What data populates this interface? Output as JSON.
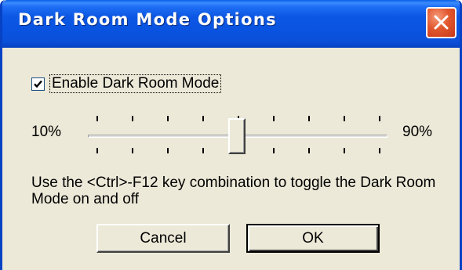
{
  "window": {
    "title": "Dark Room Mode Options"
  },
  "titlebar": {
    "close_icon": "close-x-icon"
  },
  "options": {
    "enable_checkbox": {
      "label": "Enable Dark Room Mode",
      "checked": true
    }
  },
  "slider": {
    "min_label": "10%",
    "max_label": "90%",
    "min": 10,
    "max": 90,
    "value": 50,
    "tick_count": 9
  },
  "help": {
    "text": "Use the <Ctrl>-F12 key combination to toggle the Dark Room Mode on and off"
  },
  "buttons": {
    "cancel_label": "Cancel",
    "ok_label": "OK"
  },
  "colors": {
    "titlebar": "#0a5fe6",
    "close_button": "#e2582d",
    "dialog_background": "#ece9d8"
  }
}
